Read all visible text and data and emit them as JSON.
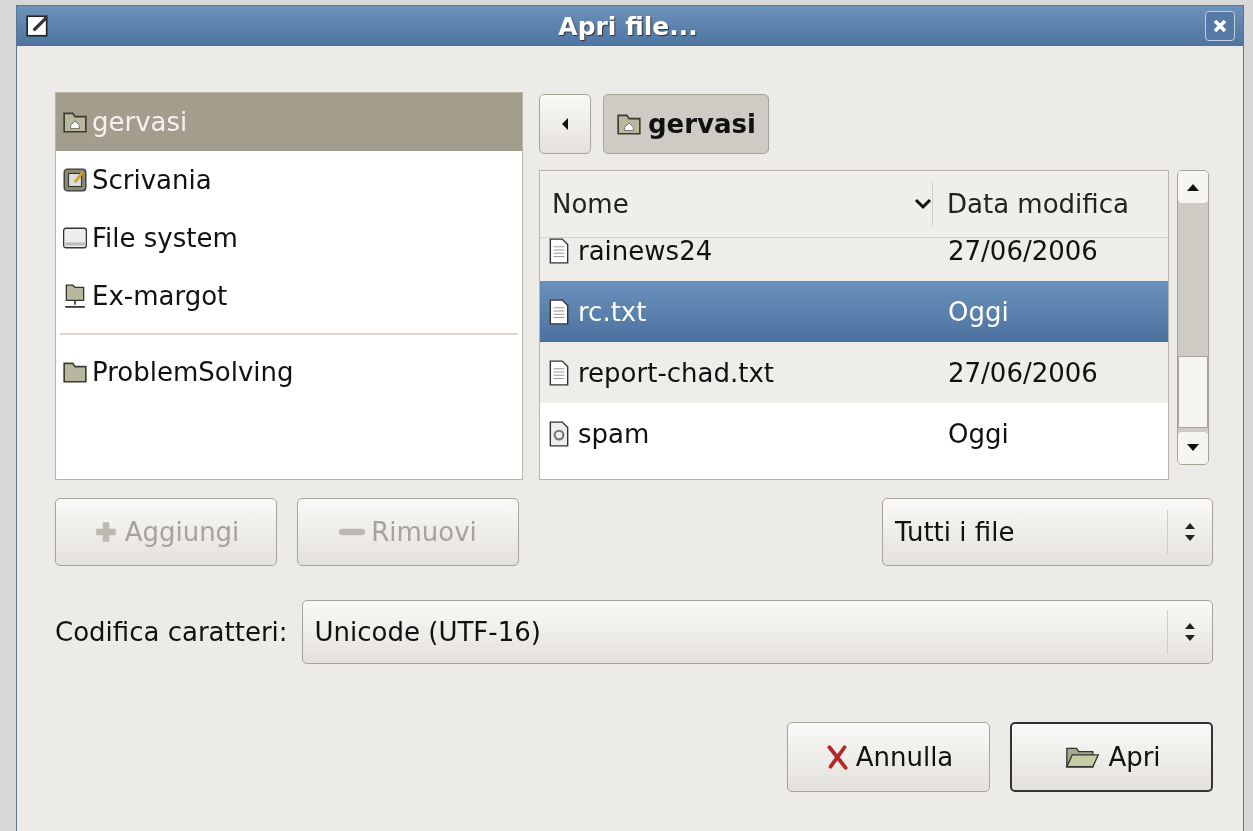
{
  "window": {
    "title": "Apri file..."
  },
  "places": [
    {
      "label": "gervasi",
      "kind": "home",
      "selected": true
    },
    {
      "label": "Scrivania",
      "kind": "desktop",
      "selected": false
    },
    {
      "label": "File system",
      "kind": "drive",
      "selected": false
    },
    {
      "label": "Ex-margot",
      "kind": "network",
      "selected": false
    },
    {
      "label": "ProblemSolving",
      "kind": "folder",
      "selected": false,
      "separator_before": true
    }
  ],
  "place_buttons": [
    {
      "label": "Aggiungi",
      "kind": "add",
      "disabled": true
    },
    {
      "label": "Rimuovi",
      "kind": "remove",
      "disabled": true
    }
  ],
  "path_bar": {
    "current": "gervasi"
  },
  "file_list": {
    "columns": [
      "Nome",
      "Data modifica"
    ],
    "rows": [
      {
        "name": "rainews24",
        "modified": "27/06/2006",
        "kind": "text",
        "selected": false
      },
      {
        "name": "rc.txt",
        "modified": "Oggi",
        "kind": "text",
        "selected": true
      },
      {
        "name": "report-chad.txt",
        "modified": "27/06/2006",
        "kind": "text",
        "selected": false
      },
      {
        "name": "spam",
        "modified": "Oggi",
        "kind": "script",
        "selected": false
      }
    ]
  },
  "filter": {
    "value": "Tutti i file"
  },
  "encoding": {
    "label": "Codifica caratteri:",
    "value": "Unicode (UTF-16)"
  },
  "buttons": [
    {
      "label": "Annulla",
      "kind": "cancel",
      "default": false
    },
    {
      "label": "Apri",
      "kind": "open",
      "default": true
    }
  ]
}
